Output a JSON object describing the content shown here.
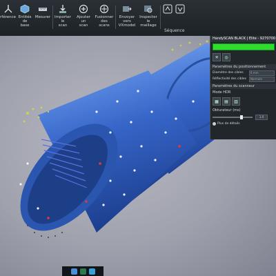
{
  "ribbon": {
    "tools": [
      {
        "id": "reference",
        "line1": "rférence",
        "line2": ""
      },
      {
        "id": "edit-base",
        "line1": "Entités de",
        "line2": "base"
      },
      {
        "id": "measure",
        "line1": "Mesurer",
        "line2": ""
      },
      {
        "id": "import-scan",
        "line1": "Importer le",
        "line2": "scan"
      },
      {
        "id": "add-scan",
        "line1": "Ajouter un",
        "line2": "scan"
      },
      {
        "id": "merge-scans",
        "line1": "Fusionner",
        "line2": "des scans"
      },
      {
        "id": "send-vxmodel",
        "line1": "Envoyer vers",
        "line2": "VXmodel"
      },
      {
        "id": "inspect-mesh",
        "line1": "Inspecter le",
        "line2": "maillage"
      }
    ],
    "group_label": "Séquence"
  },
  "panel": {
    "title": "HandySCAN BLACK | Elite - 9270700",
    "status_color": "#2fdd2f",
    "positioning_section": "Paramètres du positionnement",
    "target_diameter_label": "Diamètre des cibles",
    "target_diameter_value": "6 mm",
    "target_reflectivity_label": "Réflectivité des cibles",
    "target_reflectivity_value": "Normale",
    "scanner_section": "Paramètres du scanneur",
    "mode_label": "Mode HDR",
    "shutter_label": "Obturateur (ms)",
    "shutter_value": "1.0",
    "more_details": "Plus de détails"
  },
  "viewport": {
    "background": "#a9abb6",
    "model_color": "#3766c9"
  }
}
